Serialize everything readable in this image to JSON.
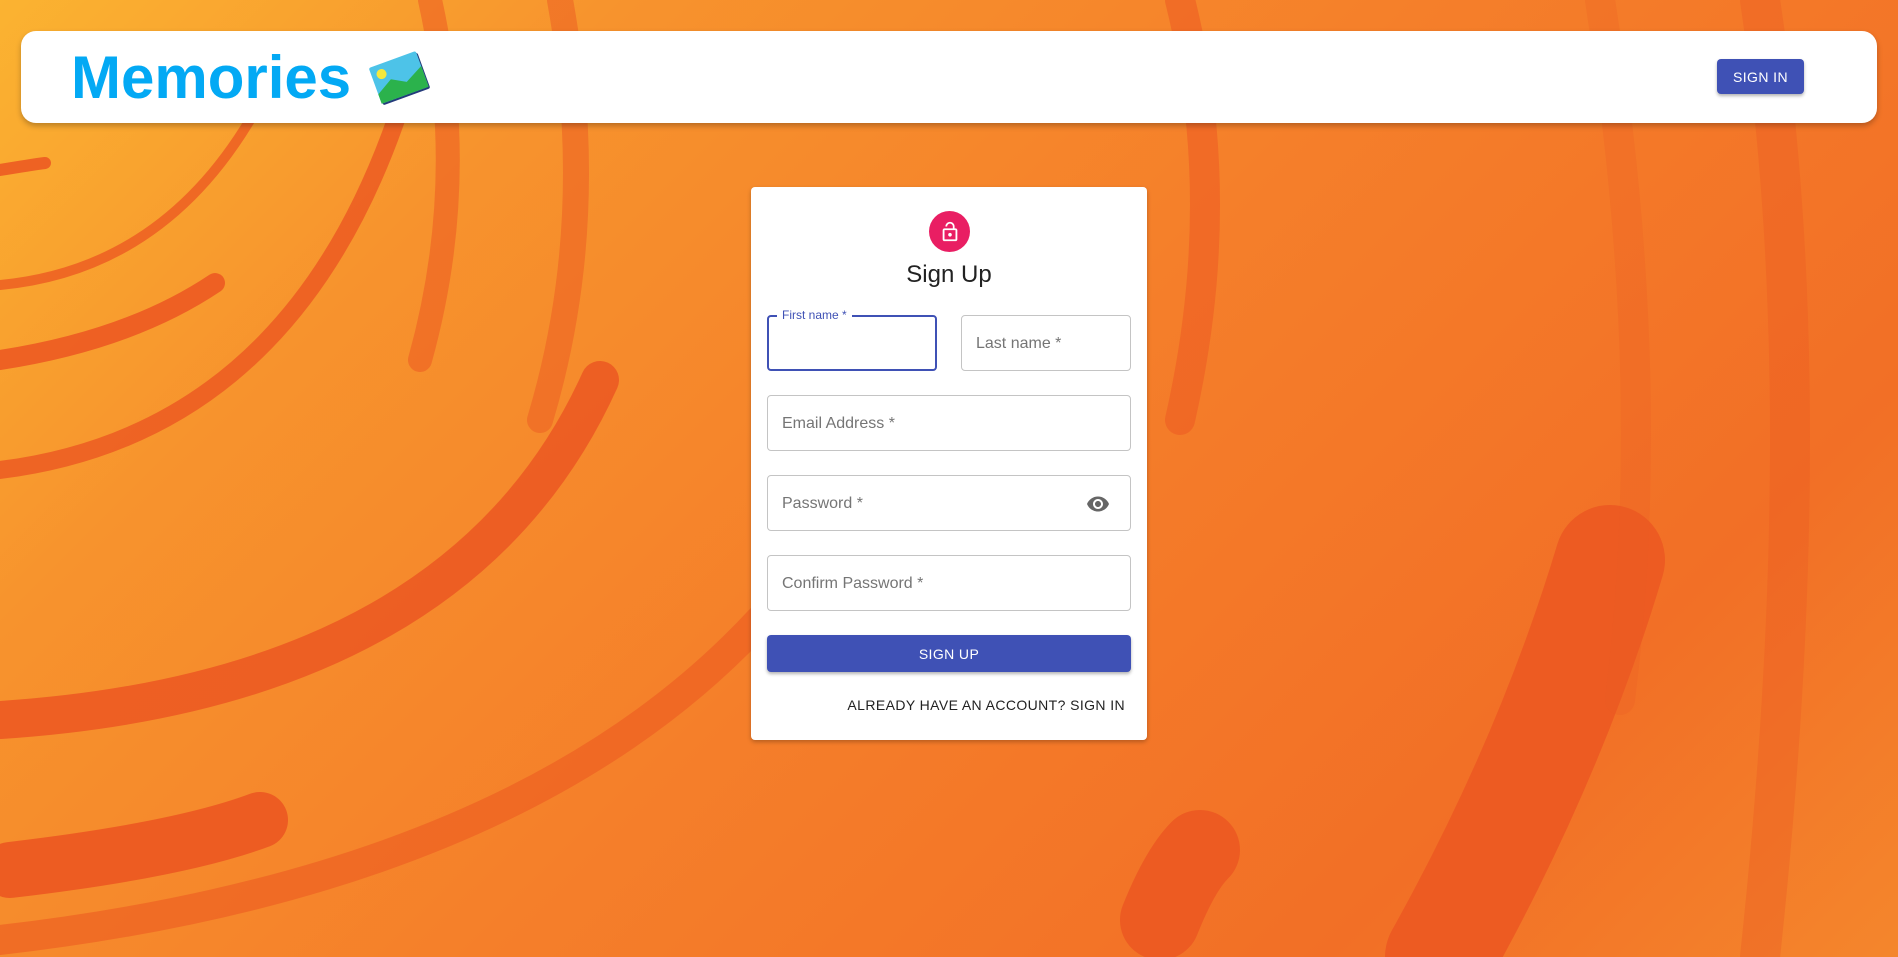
{
  "appbar": {
    "title": "Memories",
    "logo_icon": "memories-photo-icon",
    "signin_label": "SIGN IN"
  },
  "form": {
    "icon": "lock-icon",
    "title": "Sign Up",
    "fields": {
      "first_name": {
        "label": "First name *",
        "value": ""
      },
      "last_name": {
        "label": "Last name *",
        "value": ""
      },
      "email": {
        "label": "Email Address *",
        "value": ""
      },
      "password": {
        "label": "Password *",
        "value": ""
      },
      "confirm_password": {
        "label": "Confirm Password *",
        "value": ""
      }
    },
    "visibility_icon": "eye-icon",
    "submit_label": "SIGN UP",
    "switch_label": "ALREADY HAVE AN ACCOUNT? SIGN IN"
  },
  "colors": {
    "primary": "#3f51b5",
    "brand": "#03a9f4",
    "accent": "#e91e63",
    "background": "#f57f2a"
  }
}
